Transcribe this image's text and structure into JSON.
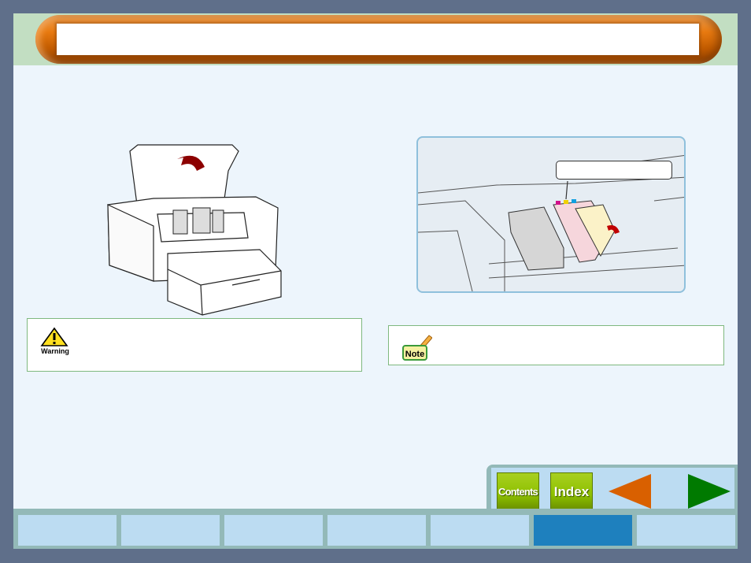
{
  "header": {
    "title": ""
  },
  "illustrations": {
    "step1": {
      "alt": "printer-top-cover-open"
    },
    "step2": {
      "alt": "print-cartridge-holder",
      "callout": ""
    }
  },
  "warning": {
    "label": "Warning",
    "text": ""
  },
  "note": {
    "label": "Note",
    "text": ""
  },
  "nav": {
    "contents_label": "Contents",
    "index_label": "Index",
    "prev_icon": "left-arrow-icon",
    "next_icon": "right-arrow-icon"
  },
  "tabs": [
    {
      "label": "",
      "active": false
    },
    {
      "label": "",
      "active": false
    },
    {
      "label": "",
      "active": false
    },
    {
      "label": "",
      "active": false
    },
    {
      "label": "",
      "active": false
    },
    {
      "label": "",
      "active": true
    },
    {
      "label": "",
      "active": false
    }
  ],
  "colors": {
    "frame": "#5f6f8a",
    "body": "#edf5fc",
    "header_band": "#c2dec2",
    "accent_orange": "#e87a10",
    "nav_green": "#8ec000",
    "active_tab": "#1e80be",
    "inactive_tab": "#bcdcf2"
  }
}
